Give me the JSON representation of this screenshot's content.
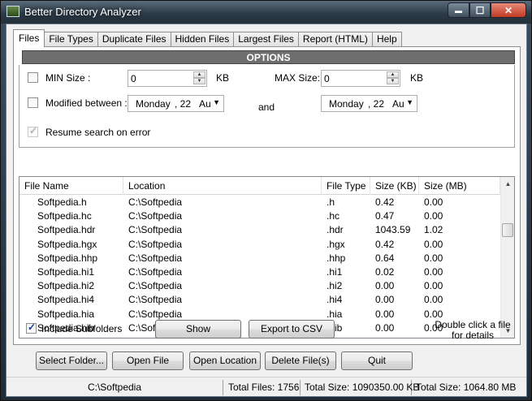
{
  "window": {
    "title": "Better Directory Analyzer",
    "buttons": {
      "minimize": "▬",
      "maximize": "☐",
      "close": "✕"
    }
  },
  "tabs": [
    {
      "label": "Files",
      "active": true
    },
    {
      "label": "File Types"
    },
    {
      "label": "Duplicate Files"
    },
    {
      "label": "Hidden Files"
    },
    {
      "label": "Largest Files"
    },
    {
      "label": "Report (HTML)"
    },
    {
      "label": "Help"
    }
  ],
  "options": {
    "header": "OPTIONS",
    "min_size": {
      "label": "MIN Size :",
      "value": "0",
      "unit": "KB",
      "checked": false
    },
    "max_size": {
      "label": "MAX Size:",
      "value": "0",
      "unit": "KB"
    },
    "modified": {
      "label": "Modified between :",
      "from": {
        "weekday": "Monday",
        "day": ", 22",
        "month": "Au"
      },
      "and_label": "and",
      "to": {
        "weekday": "Monday",
        "day": ", 22",
        "month": "Au"
      },
      "checked": false
    },
    "resume": {
      "label": "Resume search on error",
      "checked": true,
      "enabled": false
    }
  },
  "table": {
    "columns": [
      "File Name",
      "Location",
      "File Type",
      "Size (KB)",
      "Size (MB)"
    ],
    "rows": [
      [
        "Softpedia.h",
        "C:\\Softpedia",
        ".h",
        "0.42",
        "0.00"
      ],
      [
        "Softpedia.hc",
        "C:\\Softpedia",
        ".hc",
        "0.47",
        "0.00"
      ],
      [
        "Softpedia.hdr",
        "C:\\Softpedia",
        ".hdr",
        "1043.59",
        "1.02"
      ],
      [
        "Softpedia.hgx",
        "C:\\Softpedia",
        ".hgx",
        "0.42",
        "0.00"
      ],
      [
        "Softpedia.hhp",
        "C:\\Softpedia",
        ".hhp",
        "0.64",
        "0.00"
      ],
      [
        "Softpedia.hi1",
        "C:\\Softpedia",
        ".hi1",
        "0.02",
        "0.00"
      ],
      [
        "Softpedia.hi2",
        "C:\\Softpedia",
        ".hi2",
        "0.00",
        "0.00"
      ],
      [
        "Softpedia.hi4",
        "C:\\Softpedia",
        ".hi4",
        "0.00",
        "0.00"
      ],
      [
        "Softpedia.hia",
        "C:\\Softpedia",
        ".hia",
        "0.00",
        "0.00"
      ],
      [
        "Softpedia.hib",
        "C:\\Softpedia",
        ".hib",
        "0.00",
        "0.00"
      ]
    ]
  },
  "include_subfolders": {
    "label": "Include Subfolders",
    "checked": true
  },
  "buttons": {
    "show": "Show",
    "export_csv": "Export to CSV",
    "select_folder": "Select Folder...",
    "open_file": "Open File",
    "open_location": "Open Location",
    "delete_files": "Delete File(s)",
    "quit": "Quit"
  },
  "hint": {
    "line1": "Double click a file",
    "line2": "for details"
  },
  "status": {
    "folder": "C:\\Softpedia",
    "total_files": "Total Files: 1756",
    "total_size_kb": "Total Size: 1090350.00 KB",
    "total_size_mb": "Total Size: 1064.80 MB"
  }
}
